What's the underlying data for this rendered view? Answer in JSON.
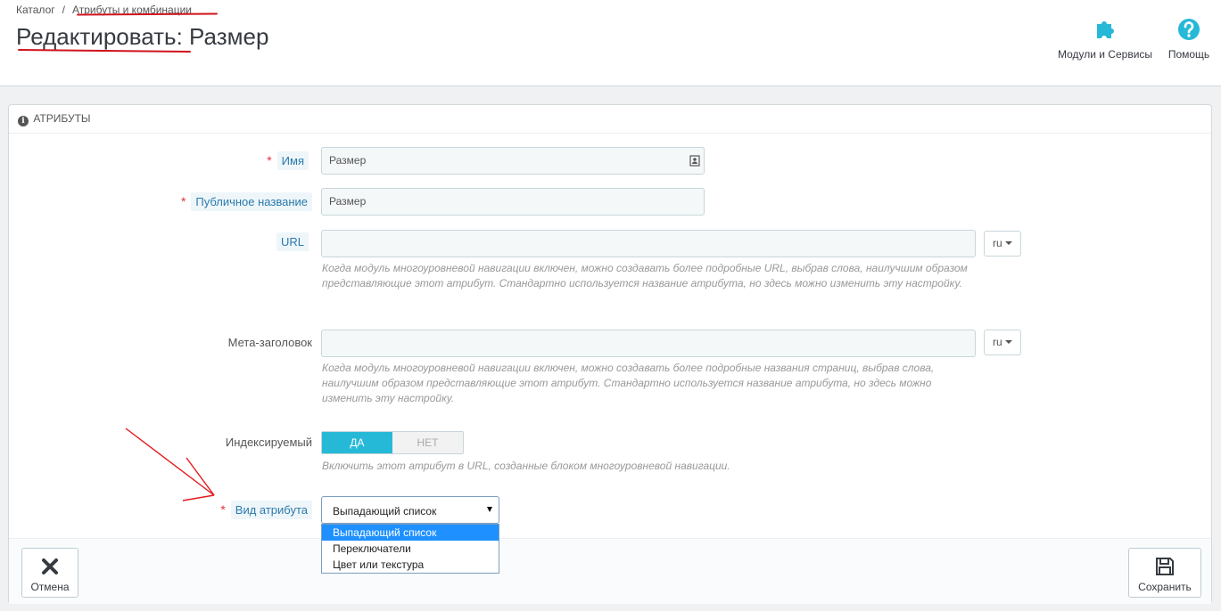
{
  "breadcrumb": {
    "item1": "Каталог",
    "separator": "/",
    "item2": "Атрибуты и комбинации"
  },
  "page": {
    "title": "Редактировать: Размер"
  },
  "toolbar": {
    "modules_label": "Модули и Сервисы",
    "help_label": "Помощь",
    "accent_color": "#25b9d7"
  },
  "panel": {
    "heading": "Атрибуты"
  },
  "form": {
    "name": {
      "label": "Имя",
      "required": "*",
      "value": "Размер"
    },
    "public_name": {
      "label": "Публичное название",
      "required": "*",
      "value": "Размер"
    },
    "url": {
      "label": "URL",
      "value": "",
      "lang": "ru",
      "help": "Когда модуль многоуровневой навигации включен, можно создавать более подробные URL, выбрав слова, наилучшим образом представляющие этот атрибут. Стандартно используется название атрибута, но здесь можно изменить эту настройку."
    },
    "meta_title": {
      "label": "Мета-заголовок",
      "value": "",
      "lang": "ru",
      "help": "Когда модуль многоуровневой навигации включен, можно создавать более подробные названия страниц, выбрав слова, наилучшим образом представляющие этот атрибут. Стандартно используется название атрибута, но здесь можно изменить эту настройку."
    },
    "indexable": {
      "label": "Индексируемый",
      "yes": "ДА",
      "no": "НЕТ",
      "selected": "ДА",
      "help": "Включить этот атрибут в URL, созданные блоком многоуровневой навигации."
    },
    "attribute_type": {
      "label": "Вид атрибута",
      "required": "*",
      "value": "Выпадающий список",
      "options": [
        "Выпадающий список",
        "Переключатели",
        "Цвет или текстура"
      ],
      "highlighted": "Выпадающий список"
    }
  },
  "footer": {
    "cancel_label": "Отмена",
    "save_label": "Сохранить"
  }
}
